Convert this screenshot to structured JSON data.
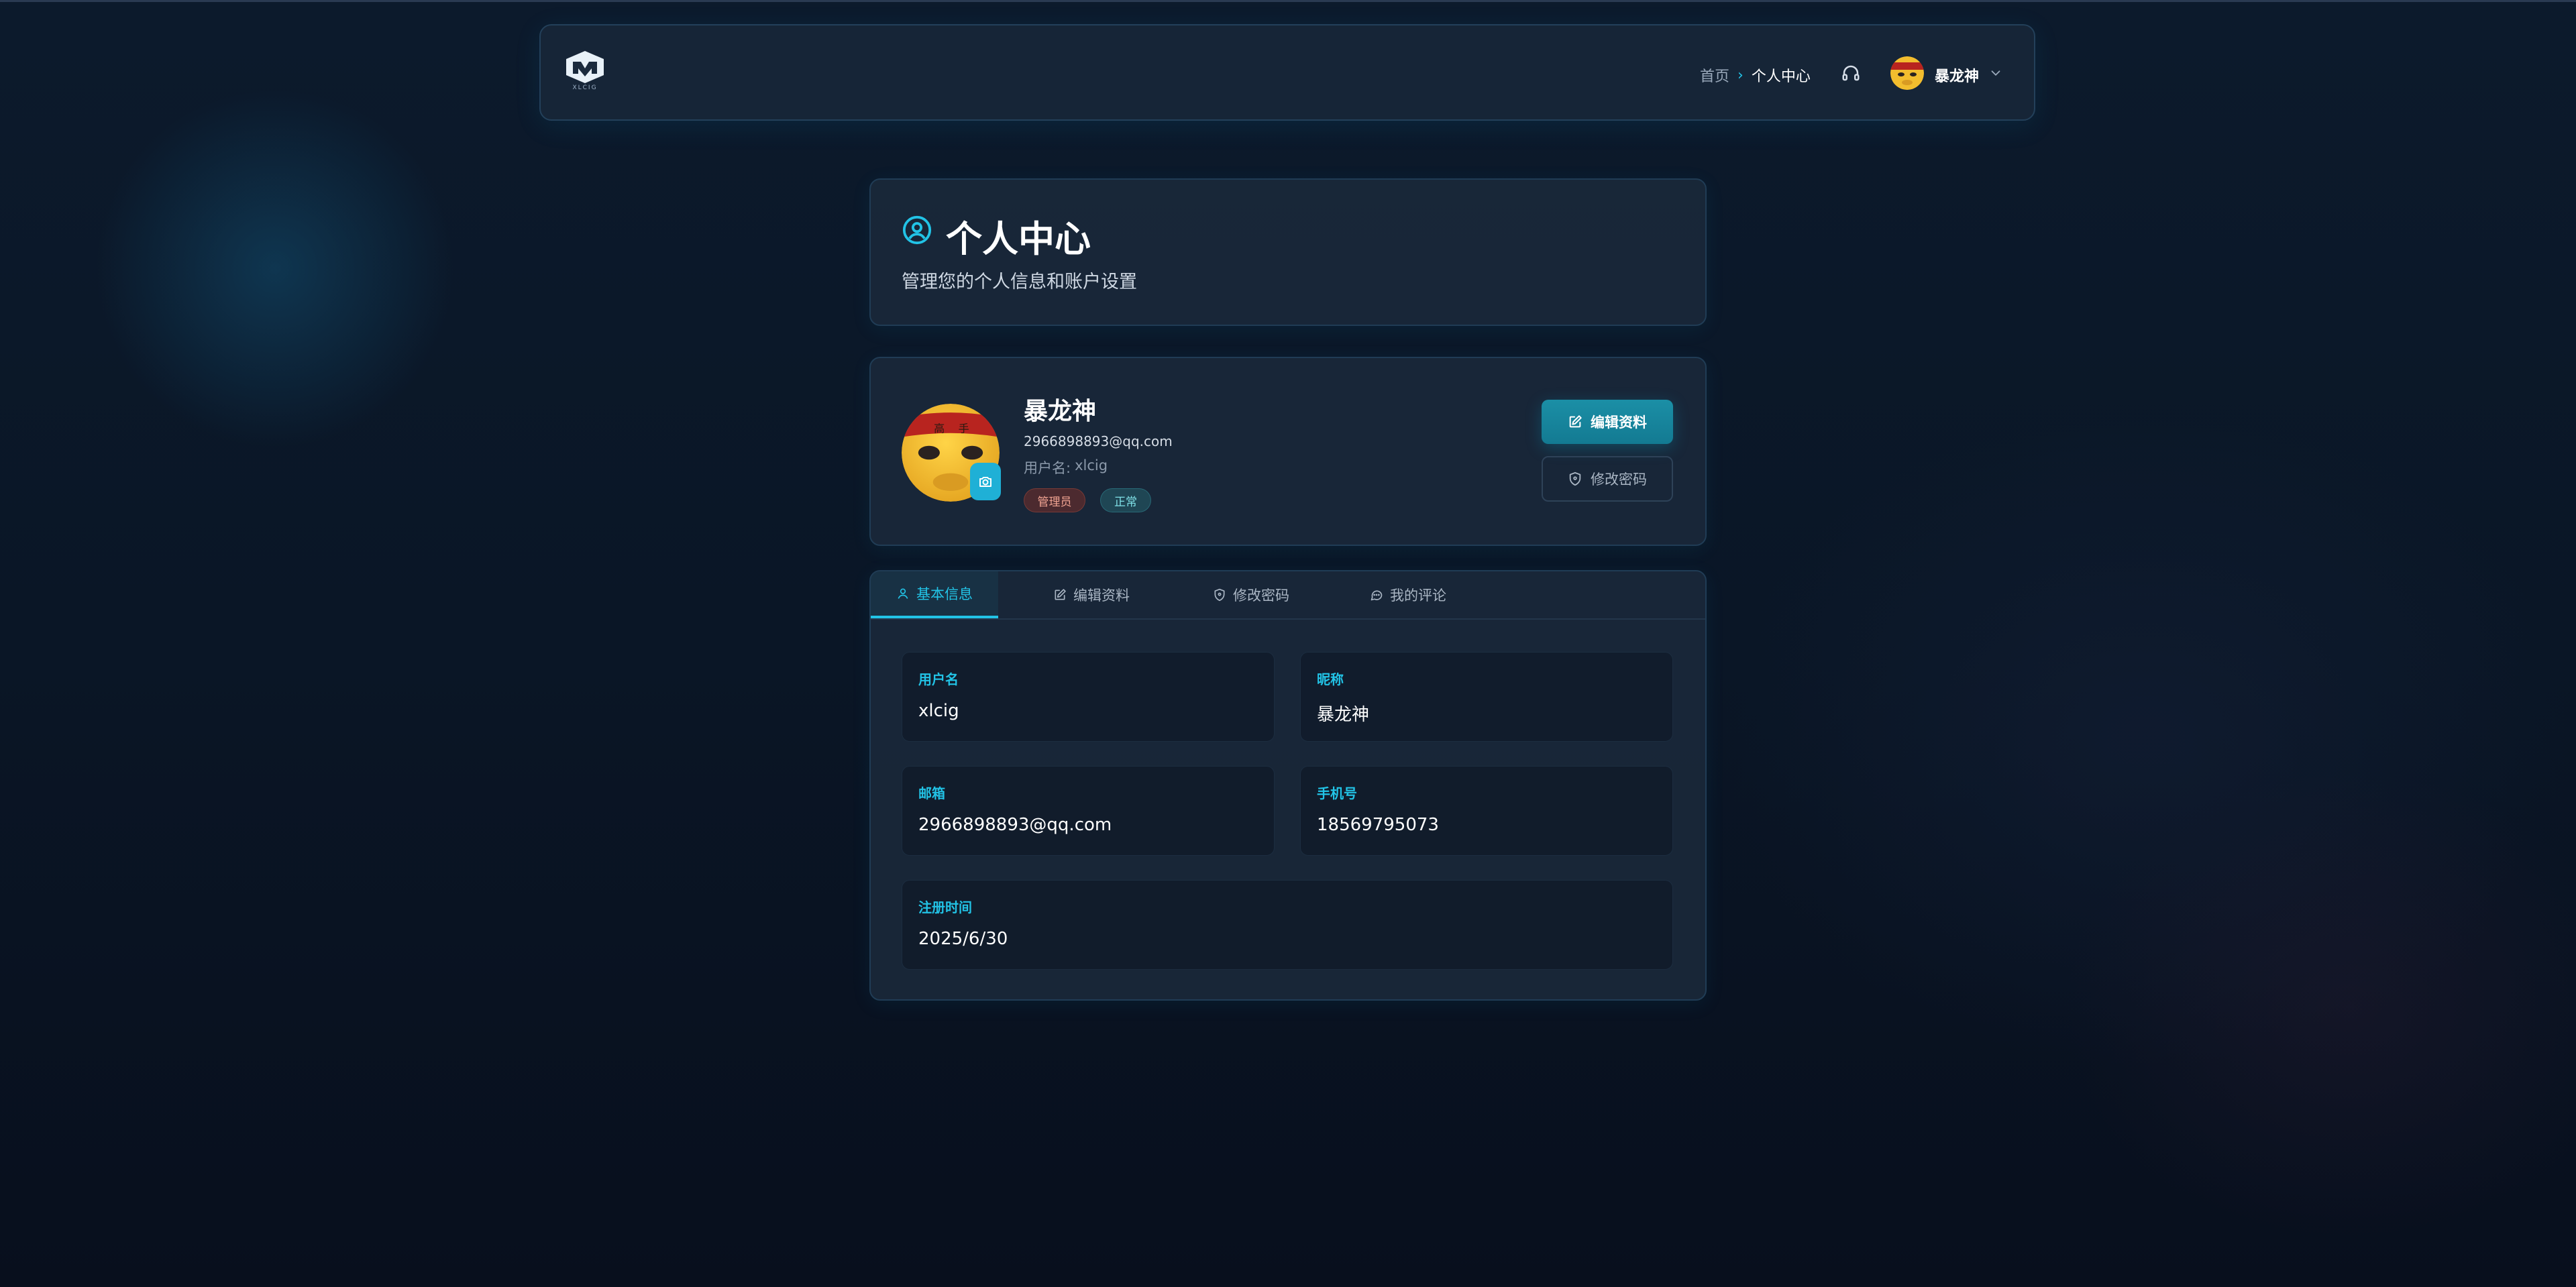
{
  "header": {
    "logo_text": "XLCIG",
    "breadcrumb": {
      "home": "首页",
      "separator": "›",
      "current": "个人中心"
    },
    "icons": {
      "support": "headset-icon",
      "menu": "chevron-down-icon"
    },
    "user": {
      "name": "暴龙神"
    }
  },
  "page": {
    "title": "个人中心",
    "subtitle": "管理您的个人信息和账户设置",
    "title_icon": "user-circle-icon"
  },
  "profile": {
    "name": "暴龙神",
    "email": "2966898893@qq.com",
    "username_label": "用户名:",
    "username": "xlcig",
    "badges": {
      "role": "管理员",
      "status": "正常"
    },
    "edit_button": "编辑资料",
    "password_button": "修改密码",
    "avatar_action_icon": "camera-icon"
  },
  "tabs": [
    {
      "label": "基本信息",
      "icon": "user-icon",
      "active": true
    },
    {
      "label": "编辑资料",
      "icon": "edit-icon",
      "active": false
    },
    {
      "label": "修改密码",
      "icon": "shield-icon",
      "active": false
    },
    {
      "label": "我的评论",
      "icon": "comment-icon",
      "active": false
    }
  ],
  "info": {
    "username": {
      "label": "用户名",
      "value": "xlcig"
    },
    "nickname": {
      "label": "昵称",
      "value": "暴龙神"
    },
    "email": {
      "label": "邮箱",
      "value": "2966898893@qq.com"
    },
    "phone": {
      "label": "手机号",
      "value": "18569795073"
    },
    "registered": {
      "label": "注册时间",
      "value": "2025/6/30"
    }
  },
  "colors": {
    "accent": "#22c3e6",
    "primary_button": "#1b8fa6",
    "admin_badge": "#f0a392",
    "status_badge": "#7fe0e6",
    "background": "#0a1626"
  }
}
